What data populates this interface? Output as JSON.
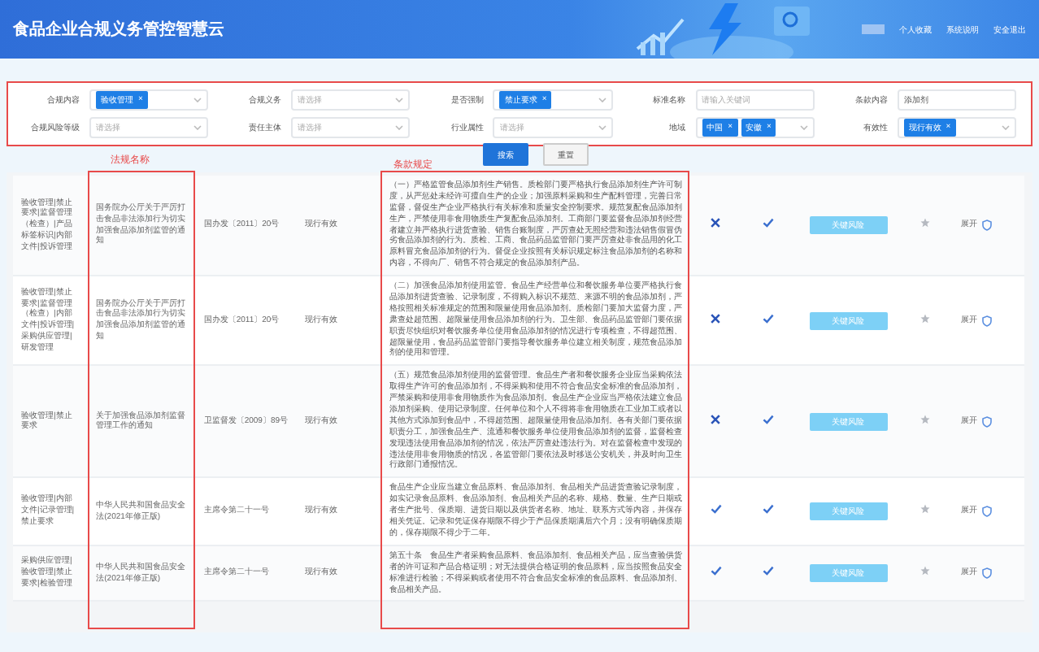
{
  "header": {
    "title": "食品企业合规义务管控智慧云",
    "menu": [
      "个人收藏",
      "系统说明",
      "安全退出"
    ]
  },
  "filters": [
    {
      "label": "合规内容",
      "kind": "tags",
      "tags": [
        {
          "text": "验收管理",
          "close": "×"
        }
      ]
    },
    {
      "label": "合规义务",
      "kind": "select",
      "placeholder": "请选择"
    },
    {
      "label": "是否强制",
      "kind": "tags",
      "tags": [
        {
          "text": "禁止要求",
          "close": "×"
        }
      ]
    },
    {
      "label": "标准名称",
      "kind": "input",
      "placeholder": "请输入关键词"
    },
    {
      "label": "条款内容",
      "kind": "input",
      "value": "添加剂"
    },
    {
      "label": "合规风险等级",
      "kind": "select",
      "placeholder": "请选择"
    },
    {
      "label": "责任主体",
      "kind": "select",
      "placeholder": "请选择"
    },
    {
      "label": "行业属性",
      "kind": "select",
      "placeholder": "请选择"
    },
    {
      "label": "地域",
      "kind": "tags",
      "tags": [
        {
          "text": "中国",
          "close": "×"
        },
        {
          "text": "安徽",
          "close": "×"
        }
      ]
    },
    {
      "label": "有效性",
      "kind": "tags",
      "tags": [
        {
          "text": "现行有效",
          "close": "×"
        }
      ]
    }
  ],
  "buttons": [
    {
      "label": "搜索",
      "kind": "primary"
    },
    {
      "label": "重置",
      "kind": "plain"
    }
  ],
  "annotations": [
    {
      "text": "法规名称"
    },
    {
      "text": "条款规定"
    }
  ],
  "table": {
    "rows": [
      {
        "category": "验收管理|禁止要求|监督管理（检查）|产品标签标识|内部文件|投诉管理",
        "name": "国务院办公厅关于严厉打击食品非法添加行为切实加强食品添加剂监管的通知",
        "number": "国办发〔2011〕20号",
        "validity": "现行有效",
        "clause": "（一）严格监管食品添加剂生产销售。质检部门要严格执行食品添加剂生产许可制度，从严惩处未经许可擅自生产的企业；加强原料采购和生产配料管理，完善日常监督，督促生产企业严格执行有关标准和质量安全控制要求。规范复配食品添加剂生产，严禁使用非食用物质生产复配食品添加剂。工商部门要监督食品添加剂经营者建立并严格执行进货查验、销售台账制度，严厉查处无照经营和违法销售假冒伪劣食品添加剂的行为。质检、工商、食品药品监管部门要严厉查处非食品用的化工原料冒充食品添加剂的行为。督促企业按照有关标识规定标注食品添加剂的名称和内容，不得向厂、销售不符合规定的食品添加剂产品。",
        "column_6": {
          "checked": false
        },
        "column_7": {
          "checked": true
        },
        "risk": "关键风险",
        "starred": false,
        "action": "展开"
      },
      {
        "category": "验收管理|禁止要求|监督管理（检查）|内部文件|投诉管理|采购供应管理|研发管理",
        "name": "国务院办公厅关于严厉打击食品非法添加行为切实加强食品添加剂监管的通知",
        "number": "国办发〔2011〕20号",
        "validity": "现行有效",
        "clause": "（二）加强食品添加剂使用监管。食品生产经营单位和餐饮服务单位要严格执行食品添加剂进货查验、记录制度，不得购入标识不规范、来源不明的食品添加剂，严格按照相关标准规定的范围和限量使用食品添加剂。质检部门要加大监督力度，严肃查处超范围、超限量使用食品添加剂的行为。卫生部、食品药品监管部门要依据职责尽快组织对餐饮服务单位使用食品添加剂的情况进行专项检查，不得超范围、超限量使用，食品药品监管部门要指导餐饮服务单位建立相关制度，规范食品添加剂的使用和管理。",
        "column_6": {
          "checked": false
        },
        "column_7": {
          "checked": true
        },
        "risk": "关键风险",
        "starred": false,
        "action": "展开"
      },
      {
        "category": "验收管理|禁止要求",
        "name": "关于加强食品添加剂监督管理工作的通知",
        "number": "卫监督发〔2009〕89号",
        "validity": "现行有效",
        "clause": "（五）规范食品添加剂使用的监督管理。食品生产者和餐饮服务企业应当采购依法取得生产许可的食品添加剂，不得采购和使用不符合食品安全标准的食品添加剂，严禁采购和使用非食用物质作为食品添加剂。食品生产企业应当严格依法建立食品添加剂采购、使用记录制度。任何单位和个人不得将非食用物质在工业加工或者以其他方式添加到食品中，不得超范围、超限量使用食品添加剂。各有关部门要依据职责分工，加强食品生产、流通和餐饮服务单位使用食品添加剂的监督，监督检查发现违法使用食品添加剂的情况，依法严厉查处违法行为。对在监督检查中发现的违法使用非食用物质的情况，各监管部门要依法及时移送公安机关，并及时向卫生行政部门通报情况。",
        "column_6": {
          "checked": false
        },
        "column_7": {
          "checked": true
        },
        "risk": "关键风险",
        "starred": false,
        "action": "展开"
      },
      {
        "category": "验收管理|内部文件|记录管理|禁止要求",
        "name": "中华人民共和国食品安全法(2021年修正版)",
        "number": "主席令第二十一号",
        "validity": "现行有效",
        "clause": "食品生产企业应当建立食品原料、食品添加剂、食品相关产品进货查验记录制度，如实记录食品原料、食品添加剂、食品相关产品的名称、规格、数量、生产日期或者生产批号、保质期、进货日期以及供货者名称、地址、联系方式等内容，并保存相关凭证。记录和凭证保存期限不得少于产品保质期满后六个月；没有明确保质期的，保存期限不得少于二年。",
        "column_6": {
          "checked": true
        },
        "column_7": {
          "checked": true
        },
        "risk": "关键风险",
        "starred": false,
        "action": "展开"
      },
      {
        "category": "采购供应管理|验收管理|禁止要求|检验管理",
        "name": "中华人民共和国食品安全法(2021年修正版)",
        "number": "主席令第二十一号",
        "validity": "现行有效",
        "clause": "第五十条　食品生产者采购食品原料、食品添加剂、食品相关产品，应当查验供货者的许可证和产品合格证明；对无法提供合格证明的食品原料，应当按照食品安全标准进行检验；不得采购或者使用不符合食品安全标准的食品原料、食品添加剂、食品相关产品。",
        "column_6": {
          "checked": true
        },
        "column_7": {
          "checked": true
        },
        "risk": "关键风险",
        "starred": false,
        "action": "展开"
      }
    ]
  }
}
